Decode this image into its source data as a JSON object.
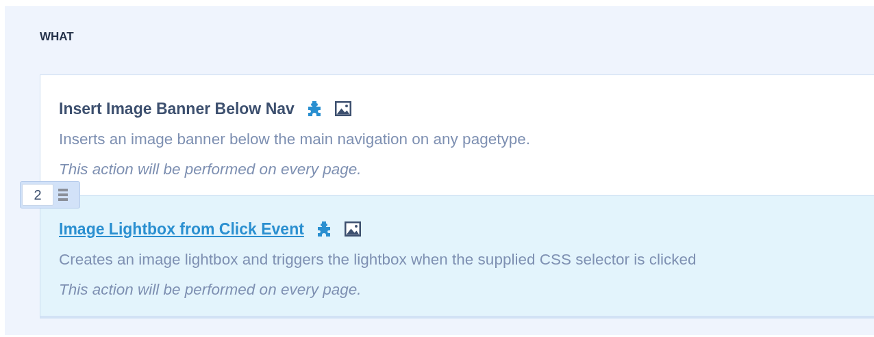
{
  "section": {
    "title": "WHAT"
  },
  "actions": [
    {
      "title": "Insert Image Banner Below Nav",
      "description": "Inserts an image banner below the main navigation on any pagetype.",
      "note": "This action will be performed on every page.",
      "selected": false
    },
    {
      "title": "Image Lightbox from Click Event",
      "description": "Creates an image lightbox and triggers the lightbox when the supplied CSS selector is clicked",
      "note": "This action will be performed on every page.",
      "selected": true,
      "order": "2"
    }
  ]
}
